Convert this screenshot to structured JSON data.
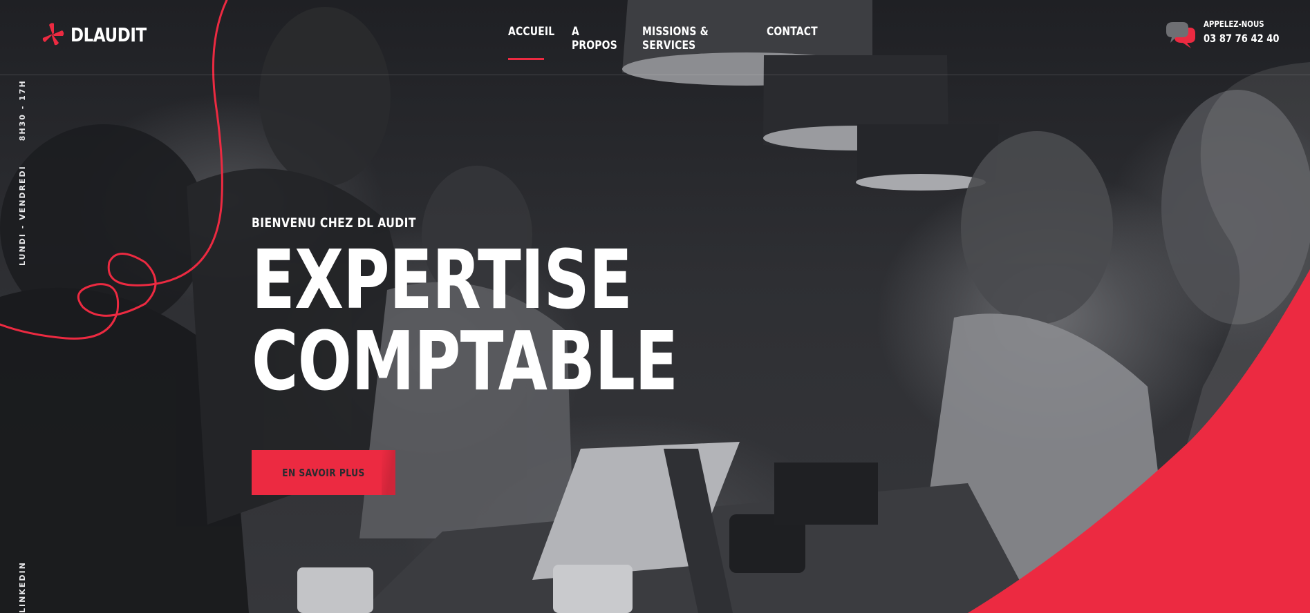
{
  "brand": {
    "name": "DLAUDIT",
    "accent_color": "#ec2a41",
    "logo_icon": "propeller-logo-icon"
  },
  "nav": {
    "items": [
      {
        "label": "ACCUEIL",
        "active": true
      },
      {
        "label": "A PROPOS",
        "active": false
      },
      {
        "label": "MISSIONS & SERVICES",
        "active": false
      },
      {
        "label": "CONTACT",
        "active": false
      }
    ]
  },
  "contact": {
    "label": "APPELEZ-NOUS",
    "number": "03 87 76 42 40",
    "icon": "chat-bubbles-icon"
  },
  "sidebar": {
    "hours": "LUNDI - VENDREDI      8H30 - 17H",
    "social": "LINKEDIN"
  },
  "hero": {
    "eyebrow": "BIENVENU CHEZ DL AUDIT",
    "headline_line1": "EXPERTISE",
    "headline_line2": "COMPTABLE",
    "cta_label": "EN SAVOIR PLUS"
  }
}
